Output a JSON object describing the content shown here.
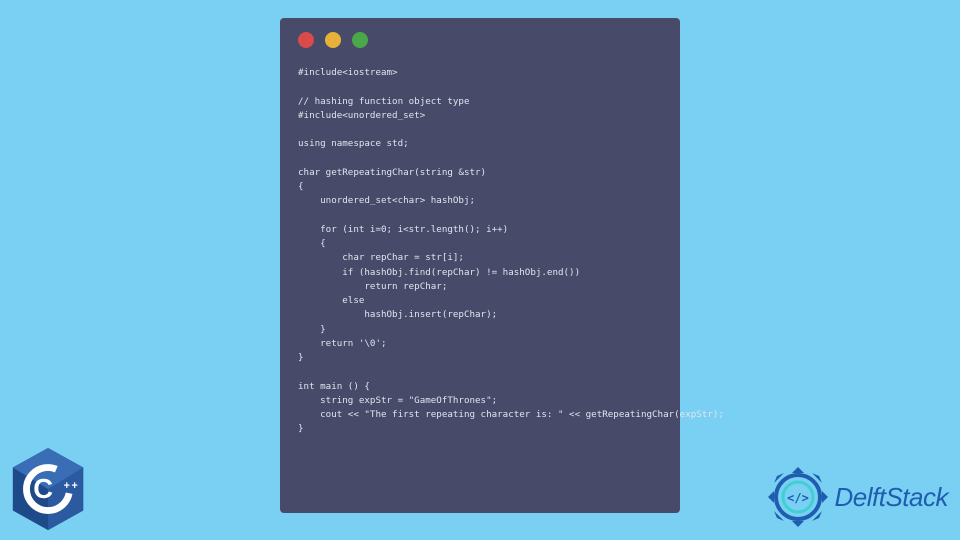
{
  "window": {
    "dots": {
      "red": "#d94a4a",
      "yellow": "#e8b23a",
      "green": "#4aa84a"
    }
  },
  "code": {
    "lines": [
      "#include<iostream>",
      "",
      "// hashing function object type",
      "#include<unordered_set>",
      "",
      "using namespace std;",
      "",
      "char getRepeatingChar(string &str)",
      "{",
      "    unordered_set<char> hashObj;",
      "",
      "    for (int i=0; i<str.length(); i++)",
      "    {",
      "        char repChar = str[i];",
      "        if (hashObj.find(repChar) != hashObj.end())",
      "            return repChar;",
      "        else",
      "            hashObj.insert(repChar);",
      "    }",
      "    return '\\0';",
      "}",
      "",
      "int main () {",
      "    string expStr = \"GameOfThrones\";",
      "    cout << \"The first repeating character is: \" << getRepeatingChar(expStr);",
      "}"
    ]
  },
  "logos": {
    "cpp": "C++",
    "delftstack": "DelftStack"
  }
}
